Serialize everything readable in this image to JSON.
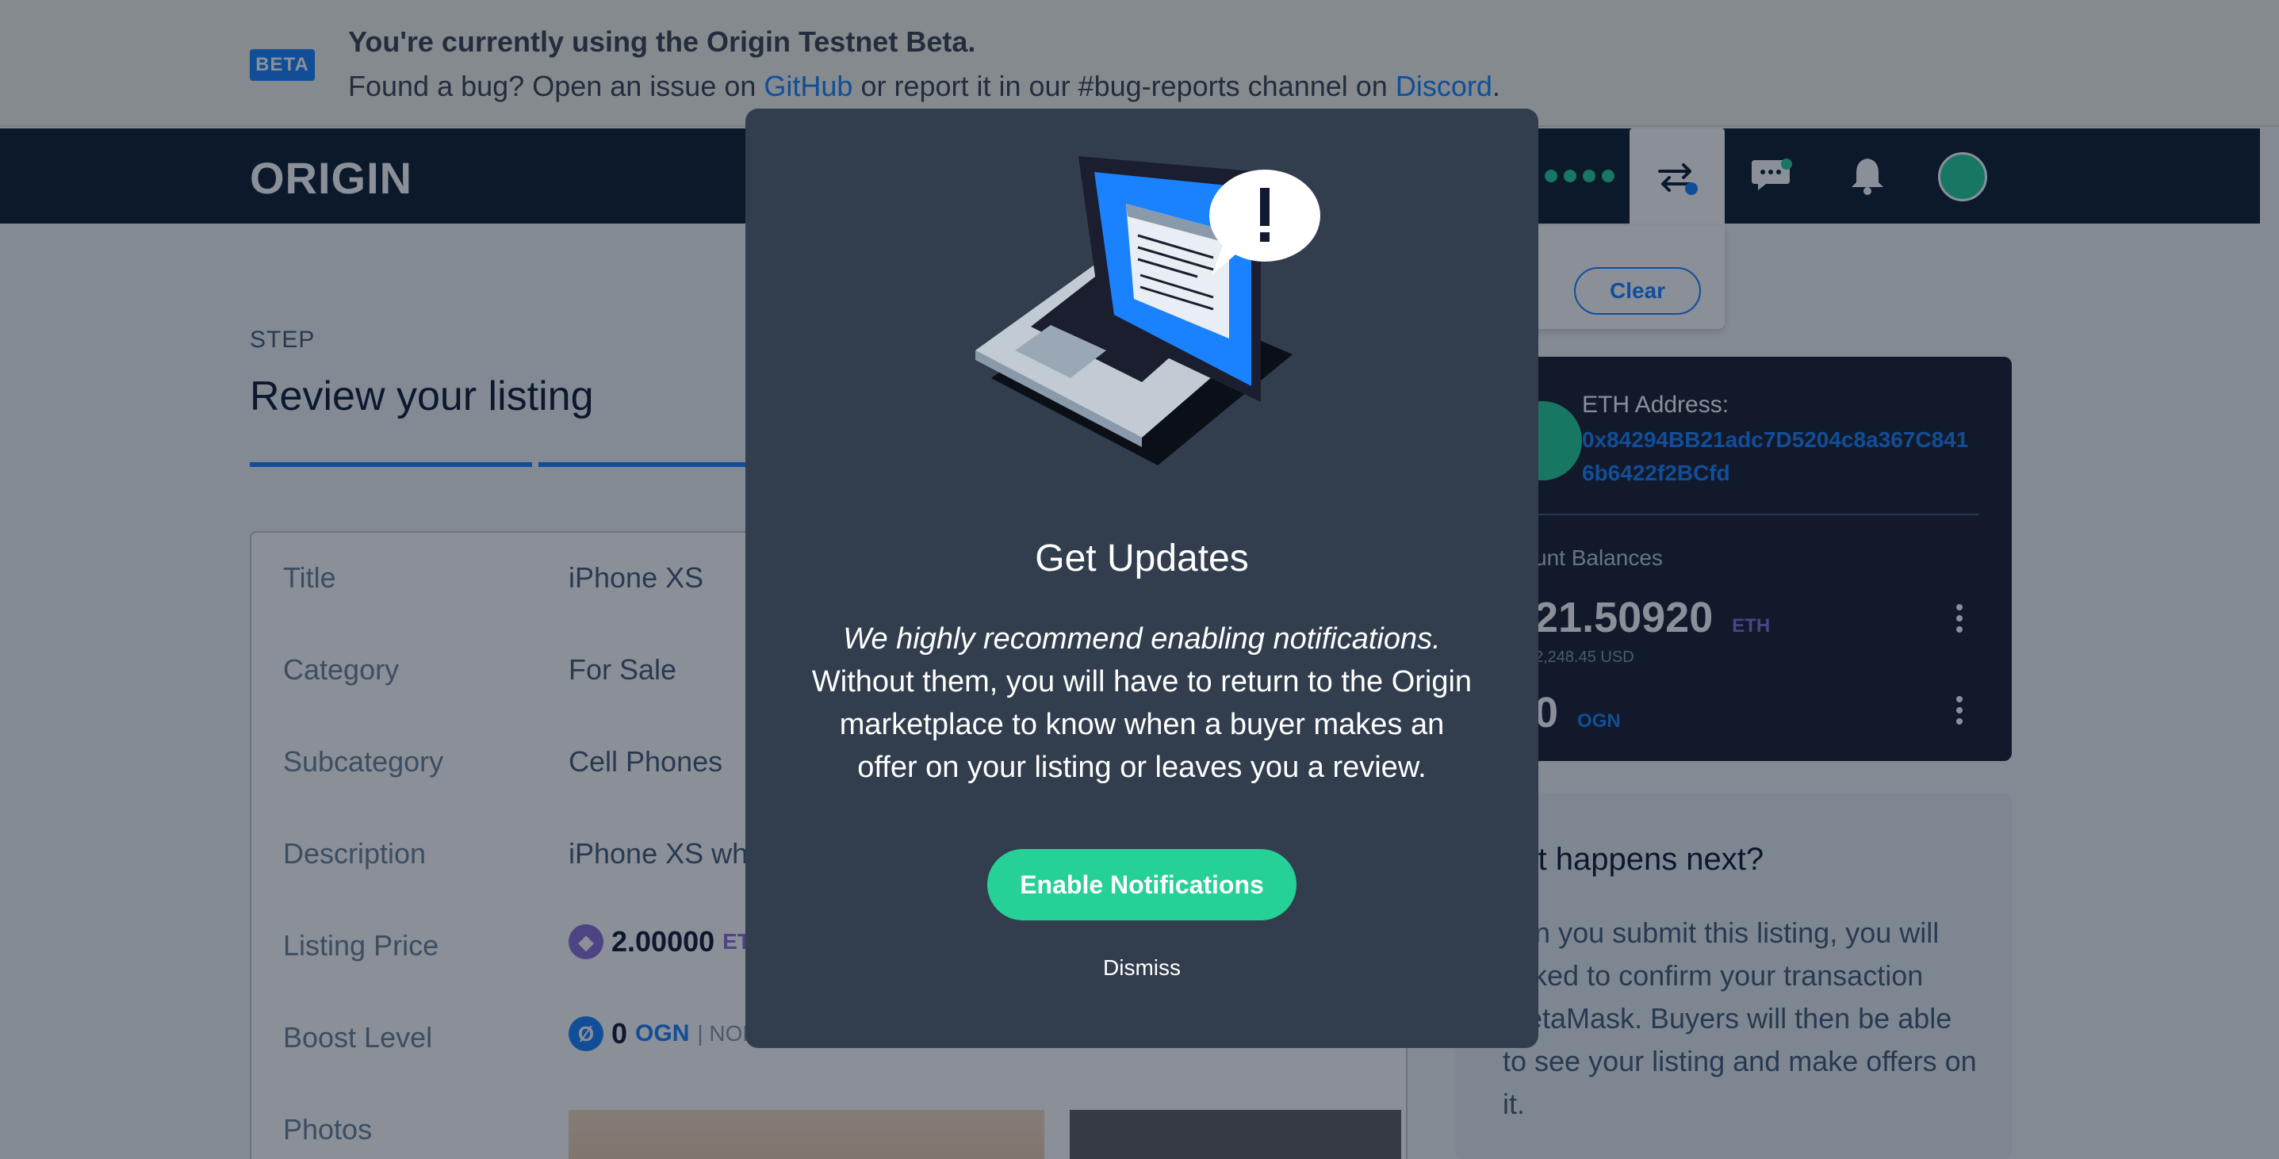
{
  "beta": {
    "badge": "BETA",
    "title": "You're currently using the Origin Testnet Beta.",
    "line_prefix": "Found a bug? Open an issue on ",
    "github_link": "GitHub",
    "line_middle": " or report it in our #bug-reports channel on ",
    "discord_link": "Discord",
    "line_suffix": "."
  },
  "nav": {
    "logo": "ORIGIN",
    "icons": [
      "status-dots-icon",
      "transfer-icon",
      "chat-icon",
      "bell-icon",
      "avatar"
    ]
  },
  "dropdown": {
    "clear_label": "Clear"
  },
  "listing": {
    "step_label": "STEP",
    "page_title": "Review your listing",
    "rows": [
      {
        "label": "Title",
        "value": "iPhone XS"
      },
      {
        "label": "Category",
        "value": "For Sale"
      },
      {
        "label": "Subcategory",
        "value": "Cell Phones"
      },
      {
        "label": "Description",
        "value": "iPhone XS whi"
      }
    ],
    "price_label": "Listing Price",
    "price_value": "2.00000",
    "price_unit": "ET",
    "boost_label": "Boost Level",
    "boost_value": "0",
    "boost_unit": "OGN",
    "boost_sep": "| NON",
    "photos_label": "Photos"
  },
  "wallet": {
    "eth_address_label": "ETH Address:",
    "eth_address": "0x84294BB21adc7D5204c8a367C8416b6422f2BCfd",
    "balances_label": "unt Balances",
    "eth_balance": "21.50920",
    "eth_unit": "ETH",
    "usd_balance": "2,248.45 USD",
    "ogn_balance": "0",
    "ogn_unit": "OGN"
  },
  "next": {
    "title": "hat happens next?",
    "body": "hen you submit this listing, you will asked to confirm your transaction MetaMask. Buyers will then be able to see your listing and make offers on it."
  },
  "modal": {
    "title": "Get Updates",
    "body_emphasis": "We highly recommend enabling notifications.",
    "body": "Without them, you will have to return to the Origin marketplace to know when a buyer makes an offer on your listing or leaves you a review.",
    "enable_button": "Enable Notifications",
    "dismiss": "Dismiss"
  },
  "colors": {
    "accent_blue": "#1a82ff",
    "green": "#26d198",
    "navy": "#0d1d2f",
    "modal_bg": "#323e4e"
  }
}
